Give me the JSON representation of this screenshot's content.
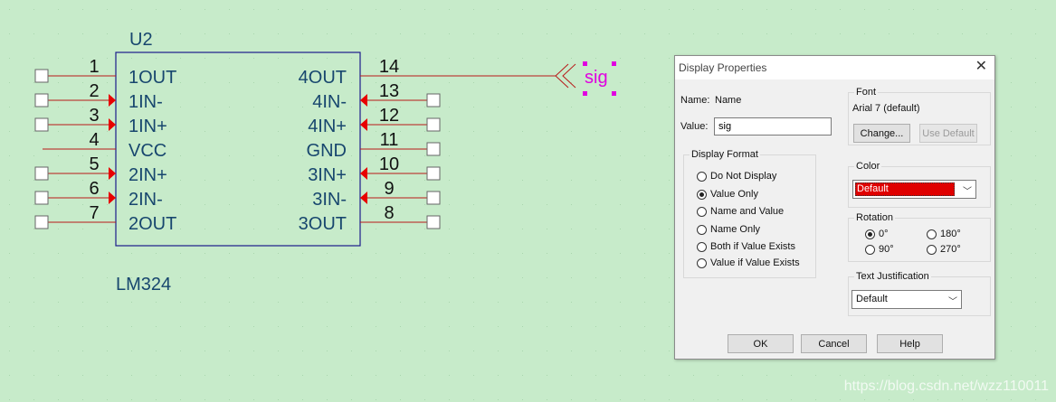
{
  "component": {
    "refdes": "U2",
    "part": "LM324",
    "left_pins": [
      {
        "number": "1",
        "name": "1OUT"
      },
      {
        "number": "2",
        "name": "1IN-"
      },
      {
        "number": "3",
        "name": "1IN+"
      },
      {
        "number": "4",
        "name": "VCC"
      },
      {
        "number": "5",
        "name": "2IN+"
      },
      {
        "number": "6",
        "name": "2IN-"
      },
      {
        "number": "7",
        "name": "2OUT"
      }
    ],
    "right_pins": [
      {
        "number": "14",
        "name": "4OUT"
      },
      {
        "number": "13",
        "name": "4IN-"
      },
      {
        "number": "12",
        "name": "4IN+"
      },
      {
        "number": "11",
        "name": "GND"
      },
      {
        "number": "10",
        "name": "3IN+"
      },
      {
        "number": "9",
        "name": "3IN-"
      },
      {
        "number": "8",
        "name": "3OUT"
      }
    ]
  },
  "net_label": "sig",
  "colors": {
    "canvas_bg": "#c7ebca",
    "part_outline": "#1c1c8c",
    "part_text": "#17466e",
    "wire": "#b81818",
    "pin_arrow": "#e80000",
    "label_selected": "#e000e0"
  },
  "dialog": {
    "title": "Display Properties",
    "name_label": "Name:",
    "name_value": "Name",
    "value_label": "Value:",
    "value_text": "sig",
    "display_format": {
      "label": "Display Format",
      "selected": "Value Only",
      "options": [
        "Do Not Display",
        "Value Only",
        "Name and Value",
        "Name Only",
        "Both if Value Exists",
        "Value if Value Exists"
      ]
    },
    "font": {
      "label": "Font",
      "current": "Arial 7 (default)",
      "change_button": "Change...",
      "use_default_button": "Use Default"
    },
    "color": {
      "label": "Color",
      "value": "Default",
      "swatch": "#e00000"
    },
    "rotation": {
      "label": "Rotation",
      "selected": "0°",
      "options": [
        "0°",
        "180°",
        "90°",
        "270°"
      ]
    },
    "text_justification": {
      "label": "Text Justification",
      "value": "Default"
    },
    "buttons": {
      "ok": "OK",
      "cancel": "Cancel",
      "help": "Help"
    }
  },
  "watermark": "https://blog.csdn.net/wzz110011"
}
